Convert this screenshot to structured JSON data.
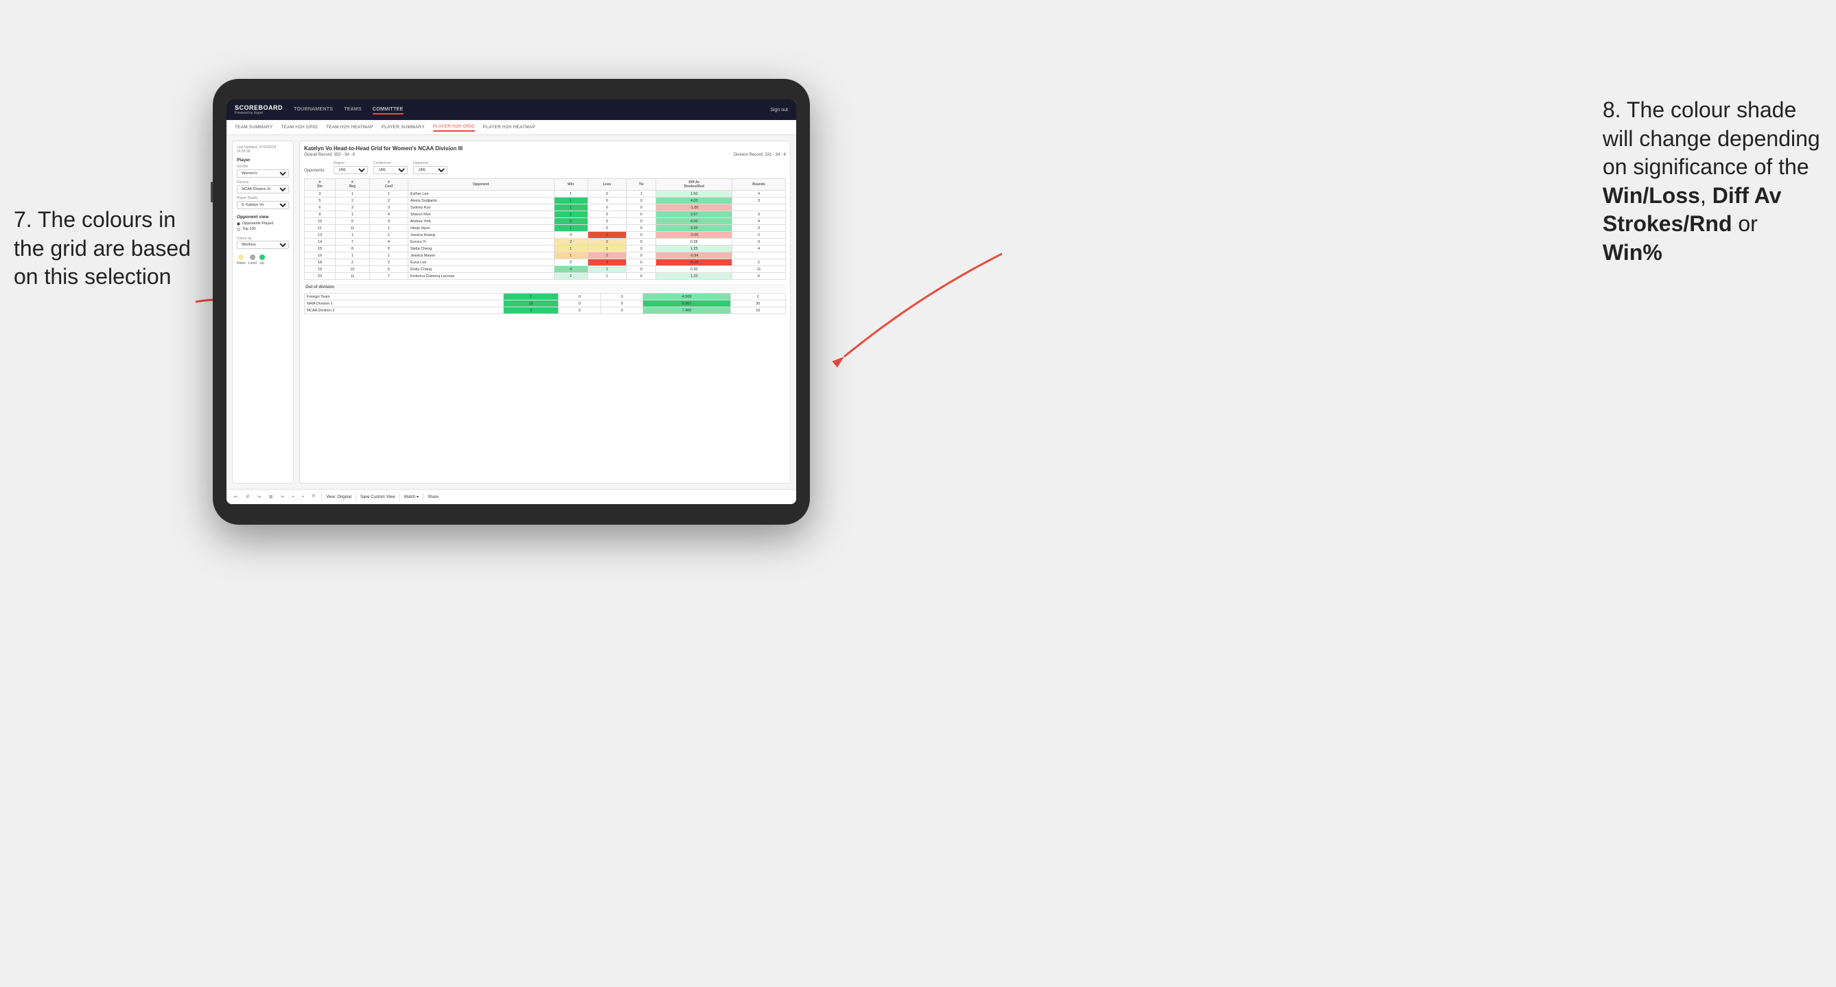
{
  "annotations": {
    "left": {
      "line1": "7. The colours in",
      "line2": "the grid are based",
      "line3": "on this selection"
    },
    "right": {
      "intro": "8. The colour shade will change depending on significance of the ",
      "bold1": "Win/Loss",
      "sep1": ", ",
      "bold2": "Diff Av Strokes/Rnd",
      "sep2": " or ",
      "bold3": "Win%"
    }
  },
  "nav": {
    "logo": "SCOREBOARD",
    "logo_sub": "Powered by clippd",
    "items": [
      "TOURNAMENTS",
      "TEAMS",
      "COMMITTEE"
    ],
    "active": "COMMITTEE",
    "sign_in": "Sign out"
  },
  "sub_nav": {
    "items": [
      "TEAM SUMMARY",
      "TEAM H2H GRID",
      "TEAM H2H HEATMAP",
      "PLAYER SUMMARY",
      "PLAYER H2H GRID",
      "PLAYER H2H HEATMAP"
    ],
    "active": "PLAYER H2H GRID"
  },
  "left_panel": {
    "last_updated_label": "Last Updated: 27/03/2024",
    "last_updated_time": "16:55:38",
    "sections": {
      "player": {
        "label": "Player",
        "gender_label": "Gender",
        "gender_value": "Women's",
        "division_label": "Division",
        "division_value": "NCAA Division III",
        "rank_label": "Player (Rank)",
        "rank_value": "8. Katelyn Vo"
      },
      "opponent_view": {
        "label": "Opponent view",
        "options": [
          "Opponents Played",
          "Top 100"
        ],
        "selected": "Opponents Played"
      },
      "colour_by": {
        "label": "Colour by",
        "value": "Win/loss"
      }
    },
    "legend": {
      "down_color": "#f9e79f",
      "level_color": "#aaaaaa",
      "up_color": "#2ecc71",
      "down_label": "Down",
      "level_label": "Level",
      "up_label": "Up"
    }
  },
  "grid": {
    "title": "Katelyn Vo Head-to-Head Grid for Women's NCAA Division III",
    "overall_record_label": "Overall Record:",
    "overall_record": "353 - 34 - 6",
    "division_record_label": "Division Record:",
    "division_record": "331 - 34 - 6",
    "filters": {
      "opponents_label": "Opponents:",
      "region_label": "Region",
      "region_value": "(All)",
      "conference_label": "Conference",
      "conference_value": "(All)",
      "opponent_label": "Opponent",
      "opponent_value": "(All)"
    },
    "table_headers": [
      "#\nDiv",
      "#\nReg",
      "#\nConf",
      "Opponent",
      "Win",
      "Loss",
      "Tie",
      "Diff Av\nStrokes/Rnd",
      "Rounds"
    ],
    "rows": [
      {
        "div": 3,
        "reg": 1,
        "conf": 1,
        "opponent": "Esther Lee",
        "win": 1,
        "loss": 0,
        "tie": 1,
        "diff": "1.50",
        "rounds": 4,
        "win_class": "cell-white",
        "loss_class": "cell-white",
        "diff_class": "cell-green-light"
      },
      {
        "div": 5,
        "reg": 2,
        "conf": 2,
        "opponent": "Alexis Sudjianto",
        "win": 1,
        "loss": 0,
        "tie": 0,
        "diff": "4.00",
        "rounds": 3,
        "win_class": "cell-green-dark",
        "loss_class": "cell-white",
        "diff_class": "cell-green-mid"
      },
      {
        "div": 6,
        "reg": 3,
        "conf": 3,
        "opponent": "Sydney Kuo",
        "win": 1,
        "loss": 0,
        "tie": 0,
        "diff": "-1.00",
        "rounds": "",
        "win_class": "cell-green-dark",
        "loss_class": "cell-white",
        "diff_class": "cell-red-light"
      },
      {
        "div": 9,
        "reg": 1,
        "conf": 4,
        "opponent": "Sharon Mun",
        "win": 1,
        "loss": 0,
        "tie": 0,
        "diff": "3.67",
        "rounds": 3,
        "win_class": "cell-green-dark",
        "loss_class": "cell-white",
        "diff_class": "cell-green-mid"
      },
      {
        "div": 10,
        "reg": 6,
        "conf": 3,
        "opponent": "Andrea York",
        "win": 2,
        "loss": 0,
        "tie": 0,
        "diff": "4.00",
        "rounds": 4,
        "win_class": "cell-green-dark",
        "loss_class": "cell-white",
        "diff_class": "cell-green-mid"
      },
      {
        "div": 11,
        "reg": 11,
        "conf": 1,
        "opponent": "Heejo Hyun",
        "win": 1,
        "loss": 0,
        "tie": 0,
        "diff": "3.33",
        "rounds": 3,
        "win_class": "cell-green-dark",
        "loss_class": "cell-white",
        "diff_class": "cell-green-mid"
      },
      {
        "div": 13,
        "reg": 1,
        "conf": 1,
        "opponent": "Jessica Huang",
        "win": 0,
        "loss": 1,
        "tie": 0,
        "diff": "-3.00",
        "rounds": 2,
        "win_class": "cell-white",
        "loss_class": "cell-red-mid",
        "diff_class": "cell-red-light"
      },
      {
        "div": 14,
        "reg": 7,
        "conf": 4,
        "opponent": "Eunice Yi",
        "win": 2,
        "loss": 2,
        "tie": 0,
        "diff": "0.38",
        "rounds": 9,
        "win_class": "cell-yellow",
        "loss_class": "cell-yellow",
        "diff_class": "cell-white"
      },
      {
        "div": 15,
        "reg": 8,
        "conf": 5,
        "opponent": "Stella Cheng",
        "win": 1,
        "loss": 1,
        "tie": 0,
        "diff": "1.25",
        "rounds": 4,
        "win_class": "cell-yellow",
        "loss_class": "cell-yellow",
        "diff_class": "cell-green-light"
      },
      {
        "div": 16,
        "reg": 1,
        "conf": 1,
        "opponent": "Jessica Mason",
        "win": 1,
        "loss": 2,
        "tie": 0,
        "diff": "-0.94",
        "rounds": "",
        "win_class": "cell-orange-light",
        "loss_class": "cell-red-light",
        "diff_class": "cell-red-light"
      },
      {
        "div": 18,
        "reg": 2,
        "conf": 2,
        "opponent": "Euna Lee",
        "win": 0,
        "loss": 3,
        "tie": 0,
        "diff": "-5.00",
        "rounds": 2,
        "win_class": "cell-white",
        "loss_class": "cell-red-mid",
        "diff_class": "cell-red-mid"
      },
      {
        "div": 19,
        "reg": 10,
        "conf": 6,
        "opponent": "Emily Chang",
        "win": 4,
        "loss": 1,
        "tie": 0,
        "diff": "0.30",
        "rounds": 11,
        "win_class": "cell-green-mid",
        "loss_class": "cell-green-light",
        "diff_class": "cell-white"
      },
      {
        "div": 20,
        "reg": 11,
        "conf": 7,
        "opponent": "Federica Domecq Lacroze",
        "win": 2,
        "loss": 1,
        "tie": 0,
        "diff": "1.33",
        "rounds": 6,
        "win_class": "cell-green-light",
        "loss_class": "cell-white",
        "diff_class": "cell-green-light"
      }
    ],
    "out_of_division_label": "Out of division",
    "out_of_division_rows": [
      {
        "opponent": "Foreign Team",
        "win": 1,
        "loss": 0,
        "tie": 0,
        "diff": "4.500",
        "rounds": 2,
        "win_class": "cell-green-dark",
        "loss_class": "cell-white",
        "diff_class": "cell-green-mid"
      },
      {
        "opponent": "NAIA Division 1",
        "win": 15,
        "loss": 0,
        "tie": 0,
        "diff": "9.267",
        "rounds": 30,
        "win_class": "cell-green-dark",
        "loss_class": "cell-white",
        "diff_class": "cell-green-dark"
      },
      {
        "opponent": "NCAA Division 2",
        "win": 5,
        "loss": 0,
        "tie": 0,
        "diff": "7.400",
        "rounds": 10,
        "win_class": "cell-green-dark",
        "loss_class": "cell-white",
        "diff_class": "cell-green-mid"
      }
    ]
  },
  "toolbar": {
    "buttons": [
      "↩",
      "↺",
      "↪",
      "⊞",
      "✂",
      "·",
      "·",
      "⏱"
    ],
    "view_original": "View: Original",
    "save_custom": "Save Custom View",
    "watch": "Watch ▾",
    "share": "Share"
  }
}
